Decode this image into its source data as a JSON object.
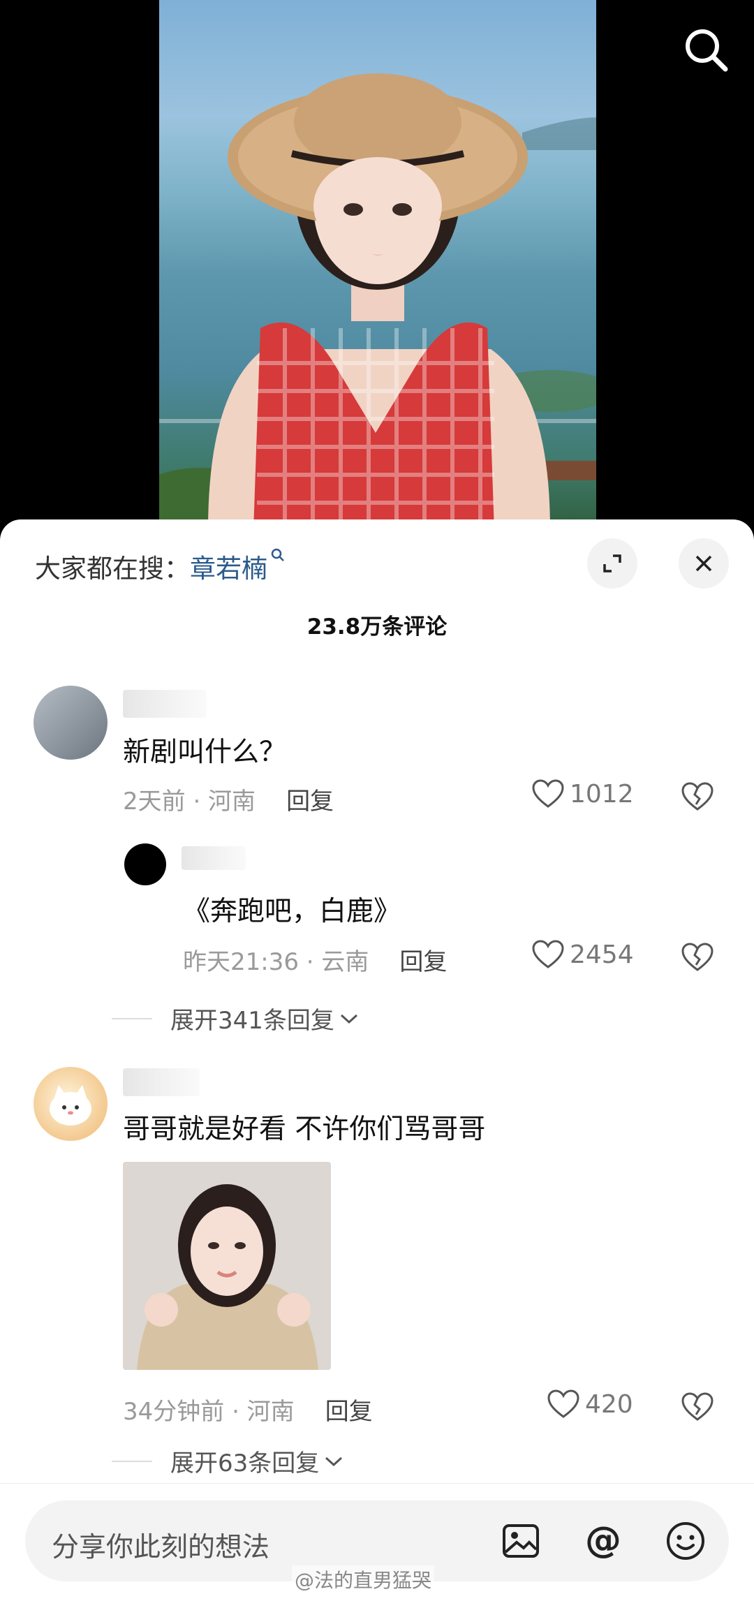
{
  "header": {
    "search_icon": "search-icon"
  },
  "sheet": {
    "hot_search_label": "大家都在搜：",
    "hot_search_keyword": "章若楠",
    "comment_count": "23.8万条评论"
  },
  "comments": [
    {
      "text": "新剧叫什么？",
      "time": "2天前 · 河南",
      "reply": "回复",
      "likes": "1012",
      "replies": [
        {
          "text": "《奔跑吧，白鹿》",
          "time": "昨天21:36 · 云南",
          "reply": "回复",
          "likes": "2454"
        }
      ],
      "expand": "展开341条回复"
    },
    {
      "text": "哥哥就是好看 不许你们骂哥哥",
      "time": "34分钟前 · 河南",
      "reply": "回复",
      "likes": "420",
      "expand": "展开63条回复"
    }
  ],
  "input": {
    "placeholder": "分享你此刻的想法"
  },
  "watermark": "@法的直男猛哭"
}
